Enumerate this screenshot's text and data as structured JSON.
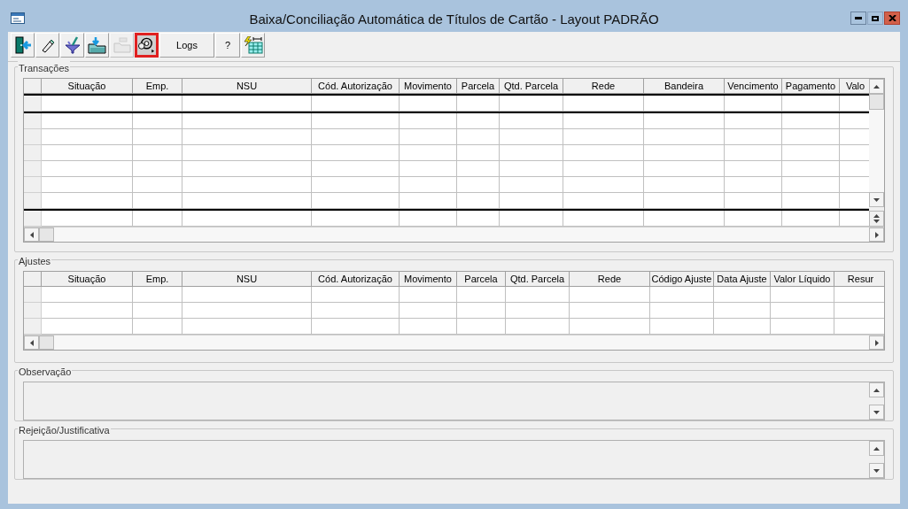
{
  "window": {
    "title": "Baixa/Conciliação Automática de Títulos de Cartão - Layout PADRÃO"
  },
  "toolbar": [
    {
      "kind": "exit",
      "disabled": false,
      "selected": false
    },
    {
      "kind": "eraser",
      "disabled": false,
      "selected": false
    },
    {
      "kind": "filter",
      "disabled": false,
      "selected": false
    },
    {
      "kind": "import",
      "disabled": false,
      "selected": false
    },
    {
      "kind": "folder",
      "disabled": true,
      "selected": false
    },
    {
      "kind": "search",
      "disabled": false,
      "selected": true
    },
    {
      "kind": "text",
      "label": "Logs",
      "disabled": false,
      "selected": false
    },
    {
      "kind": "text",
      "label": "?",
      "disabled": false,
      "selected": false
    },
    {
      "kind": "grid",
      "disabled": false,
      "selected": false
    }
  ],
  "transacoes": {
    "title": "Transações",
    "columns": [
      "Situação",
      "Emp.",
      "NSU",
      "Cód. Autorização",
      "Movimento",
      "Parcela",
      "Qtd. Parcela",
      "Rede",
      "Bandeira",
      "Vencimento",
      "Pagamento",
      "Valo"
    ]
  },
  "ajustes": {
    "title": "Ajustes",
    "columns": [
      "Situação",
      "Emp.",
      "NSU",
      "Cód. Autorização",
      "Movimento",
      "Parcela",
      "Qtd. Parcela",
      "Rede",
      "Código Ajuste",
      "Data Ajuste",
      "Valor Líquido",
      "Resur"
    ]
  },
  "observacao": {
    "title": "Observação"
  },
  "rejeicao": {
    "title": "Rejeição/Justificativa"
  }
}
